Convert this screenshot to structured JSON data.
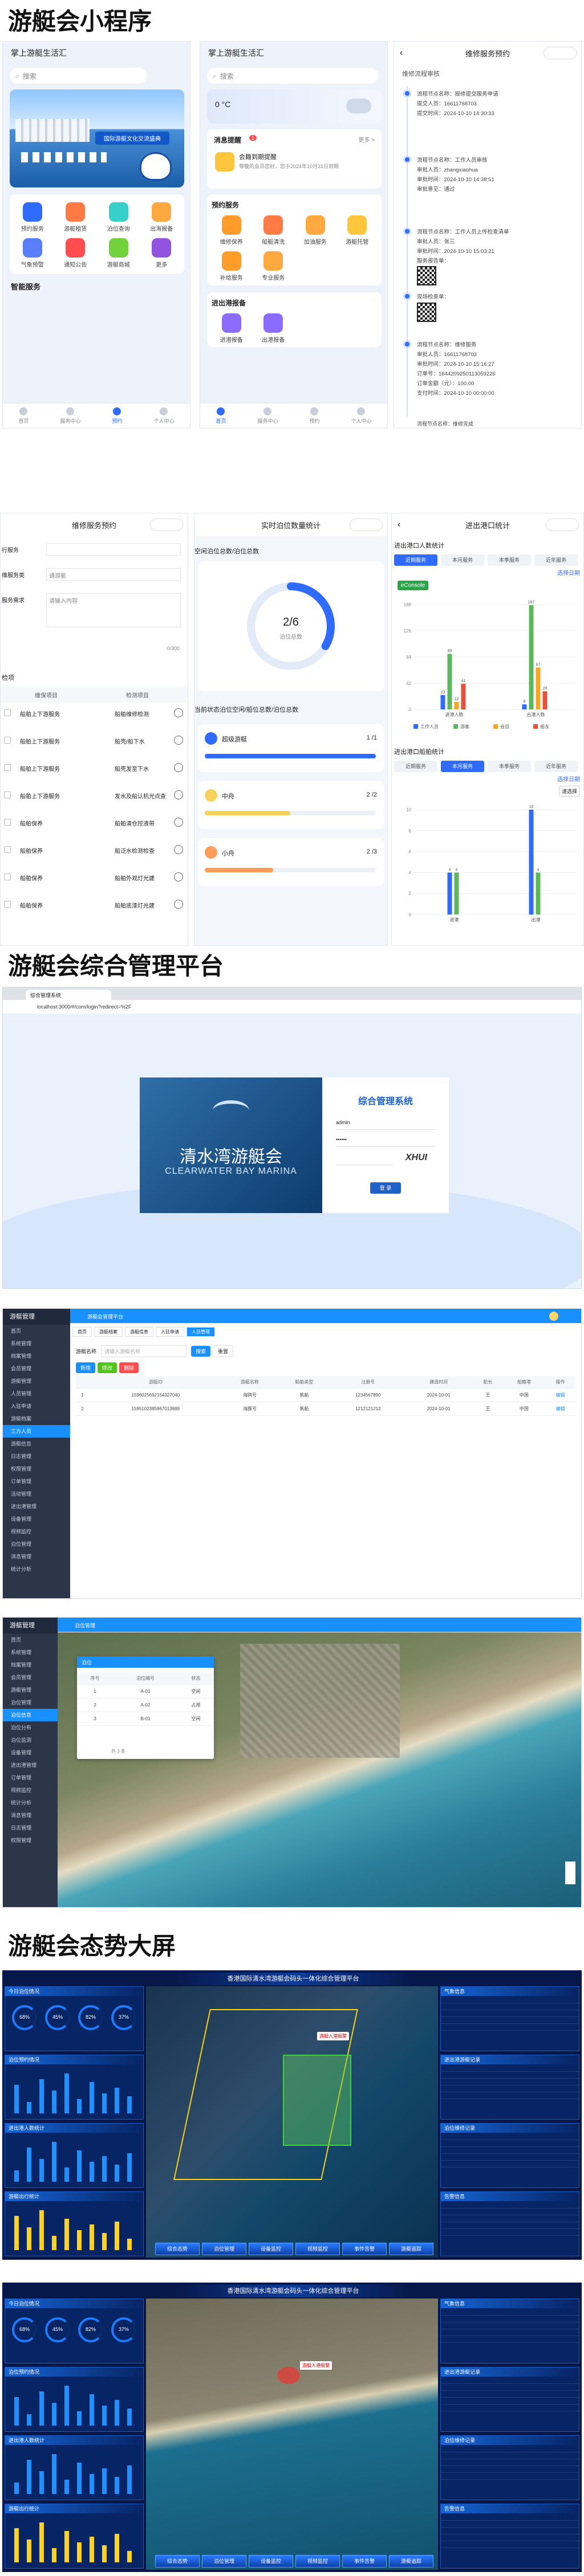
{
  "sections": {
    "miniprogram": "游艇会小程序",
    "admin": "游艇会综合管理平台",
    "dashboard": "游艇会态势大屏"
  },
  "colors": {
    "primary": "#2f6bff",
    "admin_blue": "#1890ff",
    "dash_bg": "#06184a",
    "green": "#5cb85c",
    "orange": "#f5a623"
  },
  "phone1": {
    "title": "掌上游艇生活汇",
    "search_placeholder": "搜索",
    "banner_title": "国际游艇文化交流盛典",
    "grid": [
      {
        "label": "预约服务",
        "color": "#2f6bff",
        "icon": "calendar-icon"
      },
      {
        "label": "游艇租赁",
        "color": "#ff7a45",
        "icon": "yacht-icon"
      },
      {
        "label": "泊位查询",
        "color": "#36cfc9",
        "icon": "berth-icon"
      },
      {
        "label": "出海报备",
        "color": "#ffa940",
        "icon": "report-icon"
      },
      {
        "label": "气象预警",
        "color": "#597ef7",
        "icon": "weather-icon"
      },
      {
        "label": "通知公告",
        "color": "#ff4d4f",
        "icon": "notice-icon"
      },
      {
        "label": "游艇商城",
        "color": "#73d13d",
        "icon": "shop-icon"
      },
      {
        "label": "更多",
        "color": "#9254de",
        "icon": "more-icon"
      }
    ],
    "section_label": "智能服务",
    "tabs": [
      "首页",
      "服务中心",
      "预约",
      "个人中心"
    ]
  },
  "phone2": {
    "title": "掌上游艇生活汇",
    "search_placeholder": "搜索",
    "weather": "0 °C",
    "notice_title": "消息提醒",
    "notice_badge": "1",
    "notice_more": "更多 >",
    "notice_item_title": "会籍到期提醒",
    "notice_item_text": "尊敬的会员您好，您于2024年10月31日到期",
    "reserve_title": "预约服务",
    "reserve_items": [
      "维修保养",
      "船艇清洗",
      "加油服务",
      "游艇托管",
      "补给服务",
      "专业服务"
    ],
    "warn_title": "进出港报备",
    "warn_items": [
      "进港报备",
      "出港报备"
    ],
    "tabs": [
      "首页",
      "服务中心",
      "预约",
      "个人中心"
    ]
  },
  "phone3": {
    "title": "维修服务预约",
    "header": "维修流程审核",
    "records": [
      {
        "lines": [
          "流程节点名称：报修提交服务申请",
          "提交人员：16611768703",
          "提交时间：2024-10-10 14:30:33"
        ]
      },
      {
        "lines": [
          "流程节点名称：工作人员审核",
          "审批人员：zhangxiaohua",
          "审批时间：2024-10-10 14:38:51",
          "审批意见：通过"
        ]
      },
      {
        "lines": [
          "流程节点名称：工作人员上传检查清单",
          "审批人员：张三",
          "审批时间：2024-10-10 15:03:21",
          "服务报告单："
        ]
      },
      {
        "lines": [
          "现场检查单："
        ]
      },
      {
        "lines": [
          "流程节点名称：维修服务",
          "审批人员：16611768703",
          "审批时间：2024-10-10 15:16:27",
          "订单号：1644209250113059226",
          "订单金额（元）：100.00",
          "支付时间：2024-10-10 00:00:00"
        ]
      }
    ],
    "footer_line": "流程节点名称：维修完成"
  },
  "phone4": {
    "title": "维修服务预约",
    "fields": [
      {
        "label": "行服务",
        "value": ""
      },
      {
        "label": "维服务类",
        "value": "通游艇"
      },
      {
        "label": "服务需求",
        "value": "请输入内容"
      }
    ],
    "counter": "0/300",
    "list_title": "检项",
    "col1": "维保项目",
    "col2": "检测项目",
    "rows": [
      {
        "a": "船舶上下游服务",
        "b": "船舶维修检测"
      },
      {
        "a": "船舶上下游服务",
        "b": "船壳/船下水"
      },
      {
        "a": "船舶上下游服务",
        "b": "船壳发至下水"
      },
      {
        "a": "船舶上下游服务",
        "b": "发水及船认机光点查"
      },
      {
        "a": "船舶保养",
        "b": "船舶清仓控液带"
      },
      {
        "a": "船舶保养",
        "b": "船泛水检测检查"
      },
      {
        "a": "船舶保养",
        "b": "船舶外观灯光建"
      },
      {
        "a": "船舶保养",
        "b": "船舶底漆灯光建"
      }
    ]
  },
  "phone5": {
    "title": "实时泊位数量统计",
    "block1_title": "空闲泊位总数/泊位总数",
    "ring_value": "2/6",
    "ring_label": "泊位总数",
    "ring_fraction": 0.333,
    "block2_title": "当前状态泊位空闲/船位总数/泊位总数",
    "bars": [
      {
        "label": "超级游艇",
        "value": "1 /1",
        "fraction": 1.0,
        "color": "#2f6bff"
      },
      {
        "label": "中舟",
        "value": "2 /2",
        "fraction": 0.5,
        "color": "#f5d25a"
      },
      {
        "label": "小舟",
        "value": "2 /3",
        "fraction": 0.4,
        "color": "#ff9c5a"
      }
    ]
  },
  "phone6": {
    "title": "进出港口统计",
    "chart1_title": "进出港口人数统计",
    "chart2_title": "进出港口船舶统计",
    "tabs": [
      "近期服务",
      "本月服务",
      "本季服务",
      "近年服务"
    ],
    "tab_active_chart1": 0,
    "tab_active_chart2": 1,
    "filter_label": "选择日期",
    "badge": "eConsole",
    "sort_label": "请选择",
    "legend": [
      "工作人员",
      "游客",
      "会员",
      "船东"
    ]
  },
  "chart_data": [
    {
      "type": "bar",
      "title": "进出港口人数统计",
      "categories": [
        "进港人数",
        "出港人数"
      ],
      "series": [
        {
          "name": "工作人员",
          "values": [
            23,
            8
          ]
        },
        {
          "name": "游客",
          "values": [
            89,
            167
          ]
        },
        {
          "name": "会员",
          "values": [
            12,
            67
          ]
        },
        {
          "name": "船东",
          "values": [
            41,
            29
          ]
        }
      ],
      "ylim": [
        0,
        168
      ],
      "yticks": [
        0,
        42,
        84,
        126,
        168
      ]
    },
    {
      "type": "bar",
      "title": "进出港口船舶统计",
      "categories": [
        "进港",
        "出港"
      ],
      "series": [
        {
          "name": "船舶",
          "values": [
            4,
            10
          ]
        },
        {
          "name": "游艇",
          "values": [
            4,
            4
          ]
        }
      ],
      "ylim": [
        0,
        10
      ],
      "yticks": [
        0,
        2,
        4,
        6,
        8,
        10
      ]
    }
  ],
  "login": {
    "tab": "综合管理系统",
    "url": "localhost:3000/#/com/login?redirect=%2F",
    "brand_en": "CLEARWATER BAY MARINA",
    "brand_cn": "清水湾游艇会",
    "form_title": "综合管理系统",
    "user": "admin",
    "password": "••••••",
    "captcha": "XHUI",
    "submit": "登 录"
  },
  "admin1": {
    "brand": "游艇管理",
    "tab": "游艇会管理平台",
    "menu": [
      "首页",
      "系统管理",
      "档案管理",
      "会员管理",
      "游艇管理",
      "人员管理",
      "入驻申请",
      "游艇档案",
      "三方人员",
      "游艇信息",
      "日志管理",
      "权限管理",
      "订单管理",
      "活动管理",
      "进出港管理",
      "设备管理",
      "视频监控",
      "泊位管理",
      "消息管理",
      "统计分析"
    ],
    "active": 8,
    "tabs": [
      "首页",
      "游艇档案",
      "游艇信息",
      "入驻申请",
      "人员管理"
    ],
    "search_label": "游艇名称",
    "search_ph": "请输入游艇名称",
    "btns": [
      "搜索",
      "重置"
    ],
    "ops": [
      "新增",
      "修改",
      "删除"
    ],
    "headers": [
      "",
      "游艇ID",
      "游艇名称",
      "船舶类型",
      "注册号",
      "建造时间",
      "船长",
      "船籍港",
      "操作"
    ],
    "rows": [
      [
        "1",
        "1596025692154327040",
        "海鸥号",
        "帆船",
        "1234567890",
        "2024-10-01",
        "王",
        "中国",
        "编辑"
      ],
      [
        "2",
        "1595102385967013888",
        "海豚号",
        "帆船",
        "1212121212",
        "2024-10-01",
        "王",
        "中国",
        "编辑"
      ]
    ]
  },
  "admin2": {
    "brand": "游艇管理",
    "tab": "泊位管理",
    "menu": [
      "首页",
      "系统管理",
      "档案管理",
      "会员管理",
      "游艇管理",
      "泊位管理",
      "泊位信息",
      "泊位分布",
      "泊位监测",
      "设备管理",
      "进出港管理",
      "订单管理",
      "视频监控",
      "统计分析",
      "消息管理",
      "日志管理",
      "权限管理"
    ],
    "active": 6,
    "popup_title": "泊位",
    "popup_headers": [
      "序号",
      "泊位编号",
      "状态"
    ],
    "popup_rows": [
      [
        "1",
        "A-01",
        "空闲"
      ],
      [
        "2",
        "A-02",
        "占用"
      ],
      [
        "3",
        "B-01",
        "空闲"
      ]
    ],
    "page_info": "共 3 条"
  },
  "dash1": {
    "title": "香港国际清水湾游艇会码头一体化综合管理平台",
    "left_heads": [
      "今日泊位情况",
      "泊位预约情况",
      "进出港人数统计",
      "游艇出行统计"
    ],
    "right_heads": [
      "气象信息",
      "进出港游艇记录",
      "泊位维修记录",
      "告警信息"
    ],
    "gauges": [
      "68%",
      "45%",
      "82%",
      "37%"
    ],
    "bottom_btns": [
      "综合态势",
      "泊位管理",
      "设备监控",
      "视频监控",
      "事件告警",
      "游艇追踪"
    ],
    "alert_tag": "游艇入港报警"
  },
  "dash2": {
    "title": "香港国际清水湾游艇会码头一体化综合管理平台",
    "left_heads": [
      "今日泊位情况",
      "泊位预约情况",
      "进出港人数统计",
      "游艇出行统计"
    ],
    "right_heads": [
      "气象信息",
      "进出港游艇记录",
      "泊位维修记录",
      "告警信息"
    ],
    "gauges": [
      "68%",
      "45%",
      "82%",
      "37%"
    ],
    "bottom_btns": [
      "综合态势",
      "泊位管理",
      "设备监控",
      "视频监控",
      "事件告警",
      "游艇追踪"
    ],
    "alert_tag": "游艇入港报警"
  }
}
